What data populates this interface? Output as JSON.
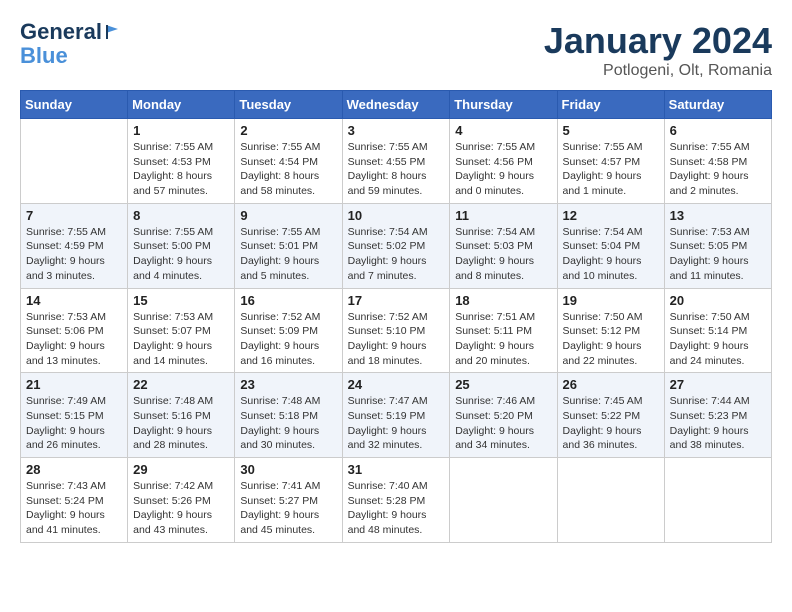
{
  "header": {
    "logo_line1": "General",
    "logo_line2": "Blue",
    "title": "January 2024",
    "subtitle": "Potlogeni, Olt, Romania"
  },
  "days_of_week": [
    "Sunday",
    "Monday",
    "Tuesday",
    "Wednesday",
    "Thursday",
    "Friday",
    "Saturday"
  ],
  "weeks": [
    [
      {
        "day": "",
        "info": ""
      },
      {
        "day": "1",
        "info": "Sunrise: 7:55 AM\nSunset: 4:53 PM\nDaylight: 8 hours\nand 57 minutes."
      },
      {
        "day": "2",
        "info": "Sunrise: 7:55 AM\nSunset: 4:54 PM\nDaylight: 8 hours\nand 58 minutes."
      },
      {
        "day": "3",
        "info": "Sunrise: 7:55 AM\nSunset: 4:55 PM\nDaylight: 8 hours\nand 59 minutes."
      },
      {
        "day": "4",
        "info": "Sunrise: 7:55 AM\nSunset: 4:56 PM\nDaylight: 9 hours\nand 0 minutes."
      },
      {
        "day": "5",
        "info": "Sunrise: 7:55 AM\nSunset: 4:57 PM\nDaylight: 9 hours\nand 1 minute."
      },
      {
        "day": "6",
        "info": "Sunrise: 7:55 AM\nSunset: 4:58 PM\nDaylight: 9 hours\nand 2 minutes."
      }
    ],
    [
      {
        "day": "7",
        "info": "Sunrise: 7:55 AM\nSunset: 4:59 PM\nDaylight: 9 hours\nand 3 minutes."
      },
      {
        "day": "8",
        "info": "Sunrise: 7:55 AM\nSunset: 5:00 PM\nDaylight: 9 hours\nand 4 minutes."
      },
      {
        "day": "9",
        "info": "Sunrise: 7:55 AM\nSunset: 5:01 PM\nDaylight: 9 hours\nand 5 minutes."
      },
      {
        "day": "10",
        "info": "Sunrise: 7:54 AM\nSunset: 5:02 PM\nDaylight: 9 hours\nand 7 minutes."
      },
      {
        "day": "11",
        "info": "Sunrise: 7:54 AM\nSunset: 5:03 PM\nDaylight: 9 hours\nand 8 minutes."
      },
      {
        "day": "12",
        "info": "Sunrise: 7:54 AM\nSunset: 5:04 PM\nDaylight: 9 hours\nand 10 minutes."
      },
      {
        "day": "13",
        "info": "Sunrise: 7:53 AM\nSunset: 5:05 PM\nDaylight: 9 hours\nand 11 minutes."
      }
    ],
    [
      {
        "day": "14",
        "info": "Sunrise: 7:53 AM\nSunset: 5:06 PM\nDaylight: 9 hours\nand 13 minutes."
      },
      {
        "day": "15",
        "info": "Sunrise: 7:53 AM\nSunset: 5:07 PM\nDaylight: 9 hours\nand 14 minutes."
      },
      {
        "day": "16",
        "info": "Sunrise: 7:52 AM\nSunset: 5:09 PM\nDaylight: 9 hours\nand 16 minutes."
      },
      {
        "day": "17",
        "info": "Sunrise: 7:52 AM\nSunset: 5:10 PM\nDaylight: 9 hours\nand 18 minutes."
      },
      {
        "day": "18",
        "info": "Sunrise: 7:51 AM\nSunset: 5:11 PM\nDaylight: 9 hours\nand 20 minutes."
      },
      {
        "day": "19",
        "info": "Sunrise: 7:50 AM\nSunset: 5:12 PM\nDaylight: 9 hours\nand 22 minutes."
      },
      {
        "day": "20",
        "info": "Sunrise: 7:50 AM\nSunset: 5:14 PM\nDaylight: 9 hours\nand 24 minutes."
      }
    ],
    [
      {
        "day": "21",
        "info": "Sunrise: 7:49 AM\nSunset: 5:15 PM\nDaylight: 9 hours\nand 26 minutes."
      },
      {
        "day": "22",
        "info": "Sunrise: 7:48 AM\nSunset: 5:16 PM\nDaylight: 9 hours\nand 28 minutes."
      },
      {
        "day": "23",
        "info": "Sunrise: 7:48 AM\nSunset: 5:18 PM\nDaylight: 9 hours\nand 30 minutes."
      },
      {
        "day": "24",
        "info": "Sunrise: 7:47 AM\nSunset: 5:19 PM\nDaylight: 9 hours\nand 32 minutes."
      },
      {
        "day": "25",
        "info": "Sunrise: 7:46 AM\nSunset: 5:20 PM\nDaylight: 9 hours\nand 34 minutes."
      },
      {
        "day": "26",
        "info": "Sunrise: 7:45 AM\nSunset: 5:22 PM\nDaylight: 9 hours\nand 36 minutes."
      },
      {
        "day": "27",
        "info": "Sunrise: 7:44 AM\nSunset: 5:23 PM\nDaylight: 9 hours\nand 38 minutes."
      }
    ],
    [
      {
        "day": "28",
        "info": "Sunrise: 7:43 AM\nSunset: 5:24 PM\nDaylight: 9 hours\nand 41 minutes."
      },
      {
        "day": "29",
        "info": "Sunrise: 7:42 AM\nSunset: 5:26 PM\nDaylight: 9 hours\nand 43 minutes."
      },
      {
        "day": "30",
        "info": "Sunrise: 7:41 AM\nSunset: 5:27 PM\nDaylight: 9 hours\nand 45 minutes."
      },
      {
        "day": "31",
        "info": "Sunrise: 7:40 AM\nSunset: 5:28 PM\nDaylight: 9 hours\nand 48 minutes."
      },
      {
        "day": "",
        "info": ""
      },
      {
        "day": "",
        "info": ""
      },
      {
        "day": "",
        "info": ""
      }
    ]
  ]
}
